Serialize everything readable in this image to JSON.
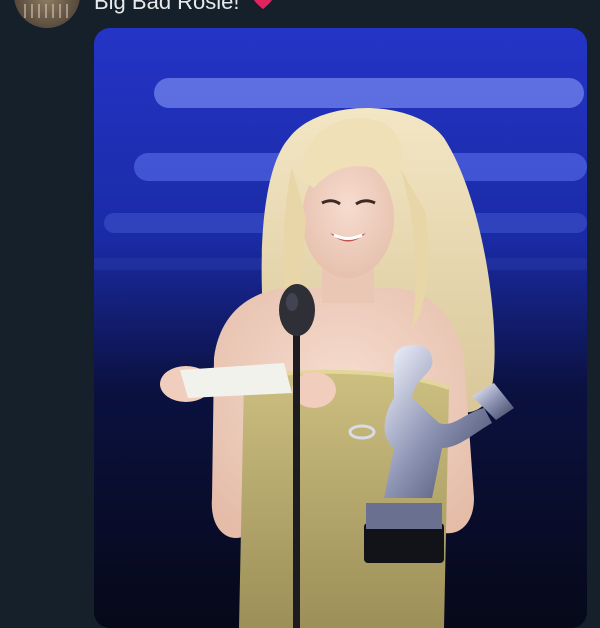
{
  "tweet": {
    "text": "Big Bad Rosie!",
    "emoji_icon": "red-heart-icon",
    "avatar_icon": "user-avatar"
  },
  "media": {
    "kind": "photo",
    "subject_icon": "award-show-photo"
  },
  "colors": {
    "background": "#15202b",
    "text": "#e7e9ea",
    "heart": "#e0245e"
  }
}
